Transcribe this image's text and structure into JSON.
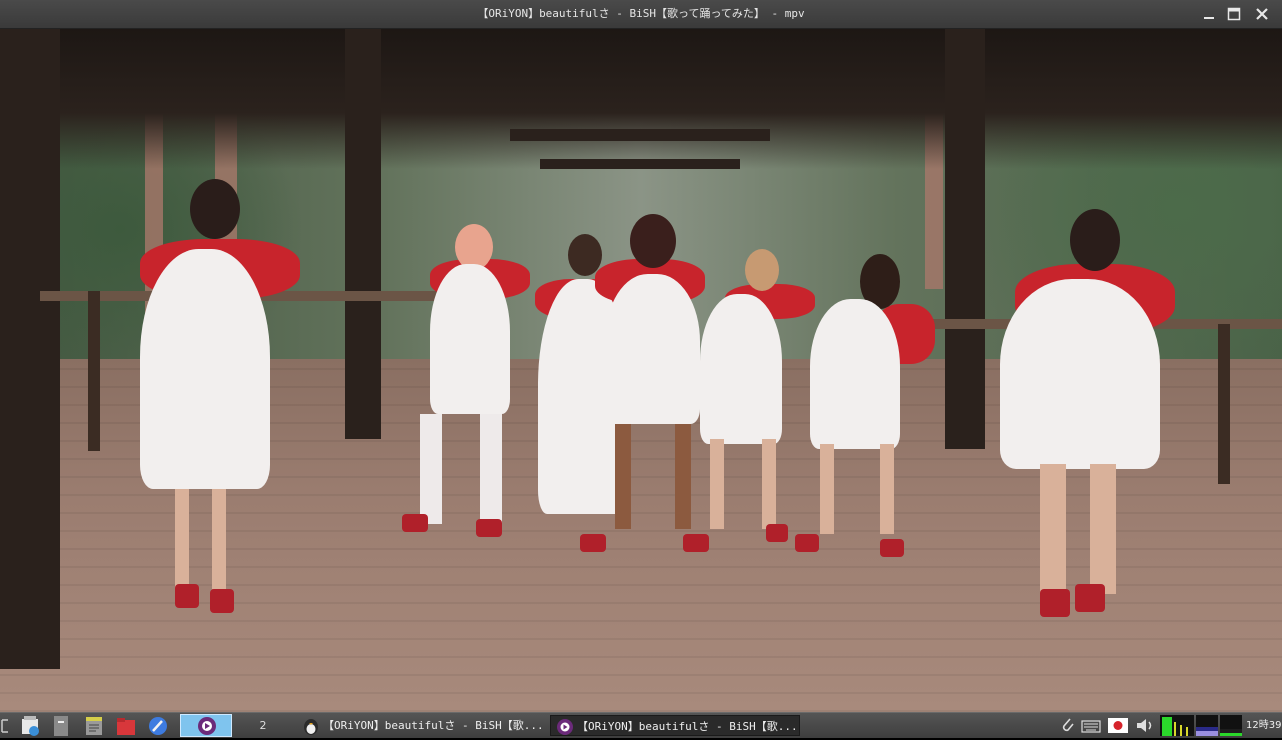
{
  "window": {
    "title": "【ORiYON】beautifulさ - BiSH【歌って踊ってみた】 - mpv"
  },
  "titlebar_buttons": {
    "minimize": "minimize-icon",
    "maximize": "maximize-icon",
    "close": "close-icon"
  },
  "taskbar": {
    "launchers": [
      "logout-icon",
      "file-manager-icon",
      "terminal-icon",
      "text-editor-icon",
      "folder-icon",
      "browser-icon"
    ],
    "workspaces": {
      "active": "1",
      "inactive_label": "2"
    },
    "tasks": [
      {
        "icon": "penguin-app-icon",
        "label": "【ORiYON】beautifulさ - BiSH【歌..."
      },
      {
        "icon": "mpv-icon",
        "label": "【ORiYON】beautifulさ - BiSH【歌..."
      }
    ],
    "tray": [
      "clipboard-icon",
      "keyboard-icon",
      "japan-flag-icon",
      "volume-icon",
      "cpu-graph-icon",
      "memory-graph-icon",
      "network-graph-icon"
    ],
    "clock": "12時39"
  },
  "colors": {
    "titlebar": "#3a3a3a",
    "taskbar": "#454545",
    "active_workspace": "#7fc4ee",
    "cape_red": "#c8242c"
  }
}
